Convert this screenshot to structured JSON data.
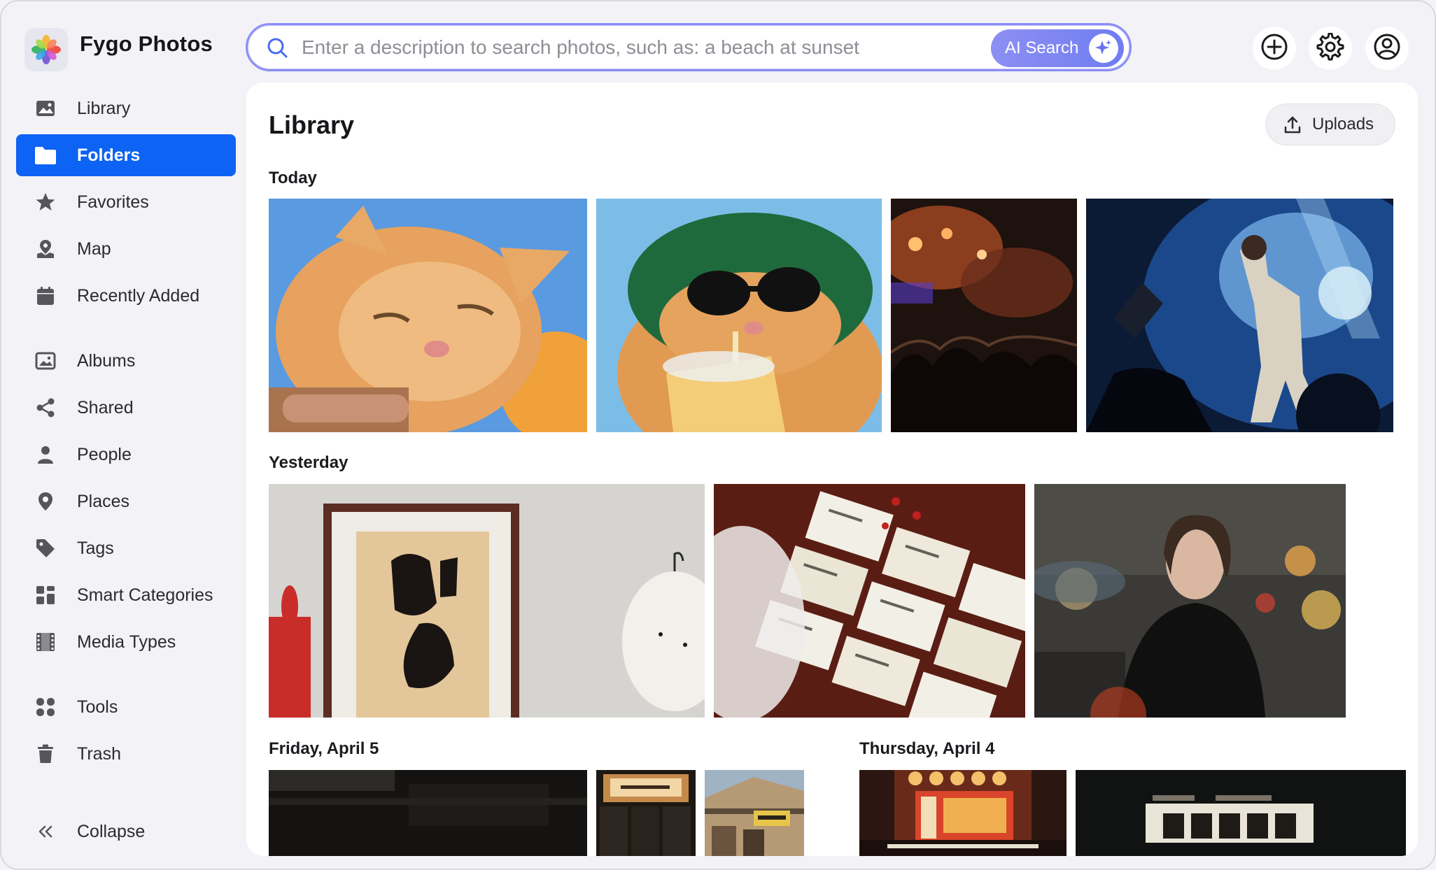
{
  "app": {
    "title": "Fygo Photos"
  },
  "search": {
    "placeholder": "Enter a description to search photos, such as: a beach at sunset",
    "ai_button_label": "AI Search"
  },
  "top_actions": [
    "add-icon",
    "gear-icon",
    "account-icon"
  ],
  "sidebar": {
    "items": [
      {
        "label": "Library",
        "icon": "image-icon",
        "active": false
      },
      {
        "label": "Folders",
        "icon": "folder-icon",
        "active": true
      },
      {
        "label": "Favorites",
        "icon": "star-icon",
        "active": false
      },
      {
        "label": "Map",
        "icon": "map-icon",
        "active": false
      },
      {
        "label": "Recently Added",
        "icon": "calendar-icon",
        "active": false
      },
      {
        "label": "Albums",
        "icon": "album-icon",
        "active": false
      },
      {
        "label": "Shared",
        "icon": "share-icon",
        "active": false
      },
      {
        "label": "People",
        "icon": "person-icon",
        "active": false
      },
      {
        "label": "Places",
        "icon": "pin-icon",
        "active": false
      },
      {
        "label": "Tags",
        "icon": "tag-icon",
        "active": false
      },
      {
        "label": "Smart Categories",
        "icon": "grid-icon",
        "active": false
      },
      {
        "label": "Media Types",
        "icon": "film-icon",
        "active": false
      },
      {
        "label": "Tools",
        "icon": "tools-icon",
        "active": false
      },
      {
        "label": "Trash",
        "icon": "trash-icon",
        "active": false
      }
    ],
    "collapse_label": "Collapse"
  },
  "main": {
    "title": "Library",
    "uploads_label": "Uploads",
    "sections": [
      {
        "title": "Today"
      },
      {
        "title": "Yesterday"
      },
      {
        "title": "Friday, April 5"
      },
      {
        "title": "Thursday, April 4"
      }
    ]
  },
  "colors": {
    "accent": "#0d63f3",
    "ai_gradient_start": "#8d8ff3",
    "ai_gradient_end": "#6f7df2"
  }
}
